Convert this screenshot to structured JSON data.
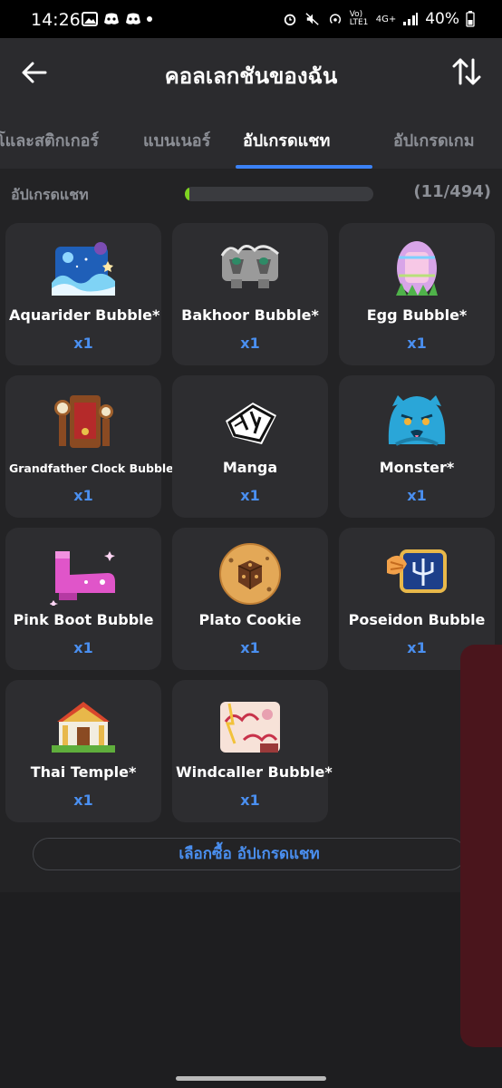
{
  "status_bar": {
    "time": "14:26",
    "volte": "Vo) LTE1",
    "network": "4G+",
    "battery": "40%"
  },
  "header": {
    "title": "คอลเลกชันของฉัน",
    "back_icon": "arrow-left-icon",
    "sort_icon": "sort-arrows-icon"
  },
  "tabs": [
    {
      "label": "โและสติกเกอร์",
      "active": false
    },
    {
      "label": "แบนเนอร์",
      "active": false
    },
    {
      "label": "อัปเกรดแชท",
      "active": true
    },
    {
      "label": "อัปเกรดเกม",
      "active": false
    }
  ],
  "progress": {
    "label": "อัปเกรดแชท",
    "count": "(11/494)",
    "owned": 11,
    "total": 494
  },
  "items": [
    {
      "name": "Aquarider Bubble*",
      "qty": "x1",
      "icon": "aquarider-icon"
    },
    {
      "name": "Bakhoor Bubble*",
      "qty": "x1",
      "icon": "bakhoor-icon"
    },
    {
      "name": "Egg Bubble*",
      "qty": "x1",
      "icon": "egg-icon"
    },
    {
      "name": "Grandfather Clock Bubble*",
      "qty": "x1",
      "icon": "grandfather-clock-icon"
    },
    {
      "name": "Manga",
      "qty": "x1",
      "icon": "manga-icon"
    },
    {
      "name": "Monster*",
      "qty": "x1",
      "icon": "monster-icon"
    },
    {
      "name": "Pink Boot Bubble",
      "qty": "x1",
      "icon": "pink-boot-icon"
    },
    {
      "name": "Plato Cookie",
      "qty": "x1",
      "icon": "cookie-icon"
    },
    {
      "name": "Poseidon Bubble",
      "qty": "x1",
      "icon": "poseidon-icon"
    },
    {
      "name": "Thai Temple*",
      "qty": "x1",
      "icon": "thai-temple-icon"
    },
    {
      "name": "Windcaller Bubble*",
      "qty": "x1",
      "icon": "windcaller-icon"
    }
  ],
  "buy_button": {
    "label": "เลือกซื้อ อัปเกรดแชท"
  },
  "colors": {
    "accent": "#3b82f6",
    "qty_text": "#4a8ff0",
    "progress_fill": "#7ed321",
    "side_panel": "#4a151c"
  }
}
